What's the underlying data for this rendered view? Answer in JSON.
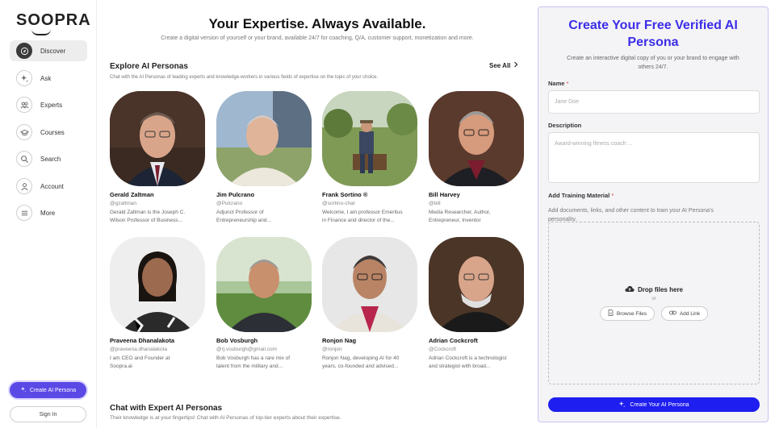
{
  "brand": {
    "logo": "SOOPRA"
  },
  "sidebar": {
    "items": [
      {
        "label": "Discover",
        "icon": "compass-icon"
      },
      {
        "label": "Ask",
        "icon": "sparkle-icon"
      },
      {
        "label": "Experts",
        "icon": "people-icon"
      },
      {
        "label": "Courses",
        "icon": "graduation-cap-icon"
      },
      {
        "label": "Search",
        "icon": "search-icon"
      },
      {
        "label": "Account",
        "icon": "user-icon"
      },
      {
        "label": "More",
        "icon": "menu-icon"
      }
    ],
    "create_label": "Create AI Persona",
    "signin_label": "Sign In"
  },
  "hero": {
    "title": "Your Expertise. Always Available.",
    "subtitle": "Create a digital version of yourself or your brand, available 24/7 for coaching, Q/A, customer support, monetization and more."
  },
  "explore": {
    "title": "Explore AI Personas",
    "subtitle": "Chat with the AI Personas of leading experts and knowledge-workers in various fields of expertise on the topic of your choice.",
    "see_all": "See All"
  },
  "personas": [
    {
      "name": "Gerald Zaltman",
      "handle": "@gzaltman",
      "desc1": "Gerald Zaltman is the Joseph C.",
      "desc2": "Wilson Professor of Business..."
    },
    {
      "name": "Jim Pulcrano",
      "handle": "@Pulcrano",
      "desc1": "Adjunct Professor of",
      "desc2": "Entrepreneurship and..."
    },
    {
      "name": "Frank Sortino ®",
      "handle": "@sortino-chat",
      "desc1": "Welcome, I am professor Emeritus",
      "desc2": "in Finance and director of the..."
    },
    {
      "name": "Bill Harvey",
      "handle": "@bill",
      "desc1": "Media Researcher, Author,",
      "desc2": "Entrepreneur, Inventor"
    },
    {
      "name": "Praveena Dhanalakota",
      "handle": "@praveena.dhanalakota",
      "desc1": "I am CEO and Founder at",
      "desc2": "Soopra.ai"
    },
    {
      "name": "Bob Vosburgh",
      "handle": "@rj.vosburgh@gmail.com",
      "desc1": "Bob Vosburgh has a rare mix of",
      "desc2": "talent from the military and..."
    },
    {
      "name": "Ronjon Nag",
      "handle": "@ronjon",
      "desc1": "Ronjon Nag, developing AI for 40",
      "desc2": "years, co-founded and advised..."
    },
    {
      "name": "Adrian Cockcroft",
      "handle": "@Cockcroft",
      "desc1": "Adrian Cockcroft is a technologist",
      "desc2": "and strategist with broad..."
    }
  ],
  "chat_section": {
    "title": "Chat with Expert AI Personas",
    "subtitle": "Their knowledge is at your fingertips! Chat with AI Personas of top-tier experts about their expertise."
  },
  "form": {
    "title_line1": "Create Your Free Verified AI",
    "title_line2": "Persona",
    "subtitle_line1": "Create an interactive digital copy of you or your brand to engage with",
    "subtitle_line2": "others 24/7.",
    "name_label": "Name",
    "required_mark": "*",
    "name_placeholder": "Jane Doe",
    "description_label": "Description",
    "description_placeholder": "Award-winning fitness coach ...",
    "training_label": "Add Training Material",
    "training_help_line1": "Add documents, links, and other content to train your AI Persona's",
    "training_help_line2": "personality.",
    "drop_label": "Drop files here",
    "or_label": "or",
    "browse_label": "Browse Files",
    "add_link_label": "Add Link",
    "submit_label": "Create Your AI Persona"
  },
  "colors": {
    "accent": "#3c2de8",
    "submit": "#1e1ef0",
    "sidebar_button": "#5b49e6"
  }
}
